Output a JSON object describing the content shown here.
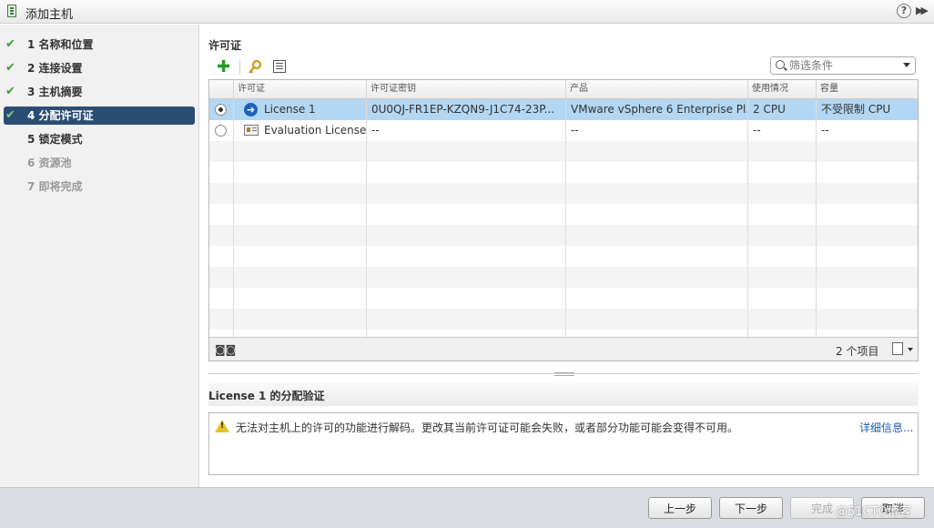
{
  "window": {
    "title": "添加主机"
  },
  "steps": [
    {
      "label": "1  名称和位置",
      "state": "done"
    },
    {
      "label": "2  连接设置",
      "state": "done"
    },
    {
      "label": "3  主机摘要",
      "state": "done"
    },
    {
      "label": "4  分配许可证",
      "state": "active"
    },
    {
      "label": "5  锁定模式",
      "state": "pending"
    },
    {
      "label": "6  资源池",
      "state": "disabled"
    },
    {
      "label": "7  即将完成",
      "state": "disabled"
    }
  ],
  "license_panel": {
    "title": "许可证",
    "filter_placeholder": "筛选条件",
    "columns": [
      "许可证",
      "许可证密钥",
      "产品",
      "使用情况",
      "容量"
    ],
    "rows": [
      {
        "selected": true,
        "icon": "arrow-right-icon",
        "name": "License 1",
        "key": "0U0QJ-FR1EP-KZQN9-J1C74-23P...",
        "product": "VMware vSphere 6 Enterprise Pl...",
        "usage": "2 CPU",
        "capacity": "不受限制 CPU"
      },
      {
        "selected": false,
        "icon": "evaluation-icon",
        "name": "Evaluation License",
        "key": "--",
        "product": "--",
        "usage": "--",
        "capacity": "--"
      }
    ],
    "item_count": "2 个项目"
  },
  "validation": {
    "title": "License 1 的分配验证",
    "message": "无法对主机上的许可的功能进行解码。更改其当前许可证可能会失败，或者部分功能可能会变得不可用。",
    "details_link": "详细信息..."
  },
  "buttons": {
    "back": "上一步",
    "next": "下一步",
    "finish": "完成",
    "cancel": "取消"
  },
  "watermark": "@51CTO博客"
}
